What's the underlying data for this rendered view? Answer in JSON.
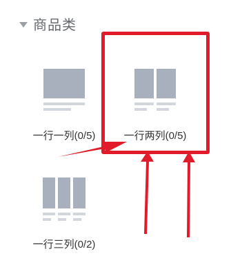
{
  "panel": {
    "section_title": "商品类",
    "items": [
      {
        "label": "一行一列(0/5)"
      },
      {
        "label": "一行两列(0/5)"
      },
      {
        "label": "一行三列(0/2)"
      }
    ]
  },
  "colors": {
    "accent": "#e21b2a",
    "thumb_block": "#a8b0bd",
    "thumb_line": "#d2d7de"
  }
}
